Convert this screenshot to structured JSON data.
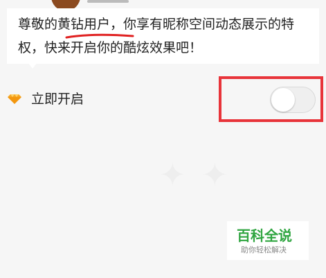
{
  "notice": {
    "text_before": "尊敬的",
    "highlight": "黄钻用户",
    "text_after": "，你享有昵称空间动态展示的特权，快来开启你的酷炫效果吧！",
    "highlight_underline_color": "#e02020"
  },
  "setting": {
    "icon": "diamond-icon",
    "label": "立即开启",
    "toggle_state": "off"
  },
  "annotation": {
    "color": "#e8343a"
  },
  "logo": {
    "title": "百科全说",
    "subtitle": "助你轻松解决",
    "color": "#2fa540"
  },
  "colors": {
    "background": "#f6f6f6",
    "card": "#ffffff",
    "diamond": "#f5a623"
  }
}
